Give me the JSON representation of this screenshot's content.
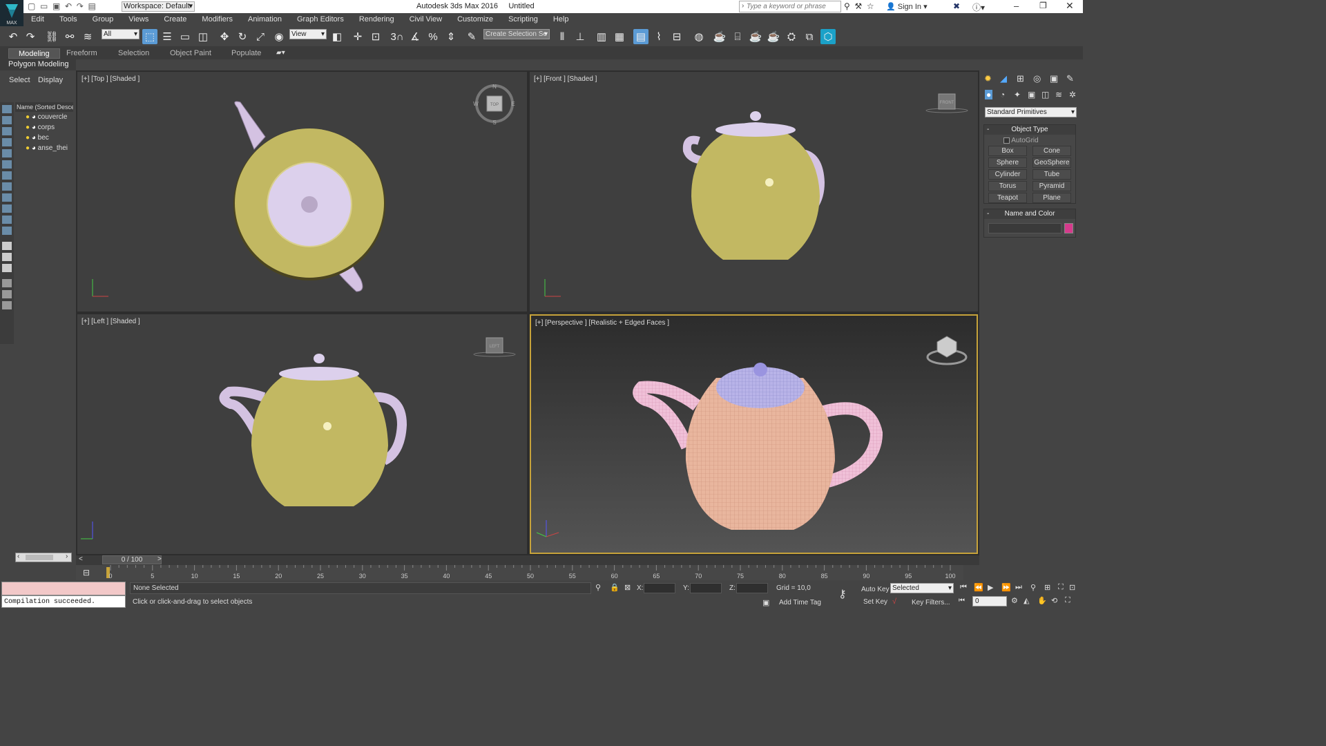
{
  "window": {
    "title": "Autodesk 3ds Max 2016",
    "doc": "Untitled",
    "workspace": "Workspace: Default",
    "search_placeholder": "Type a keyword or phrase",
    "signin": "Sign In",
    "logo_text": "MAX"
  },
  "menu": [
    "Edit",
    "Tools",
    "Group",
    "Views",
    "Create",
    "Modifiers",
    "Animation",
    "Graph Editors",
    "Rendering",
    "Civil View",
    "Customize",
    "Scripting",
    "Help"
  ],
  "toolbar": {
    "filter_value": "All",
    "refcoord_value": "View",
    "selection_set_placeholder": "Create Selection Se",
    "snap_label": "3",
    "percent_label": "%"
  },
  "ribbon": {
    "tabs": [
      "Modeling",
      "Freeform",
      "Selection",
      "Object Paint",
      "Populate"
    ],
    "active": "Modeling",
    "sub": "Polygon Modeling"
  },
  "scene_explorer": {
    "tabs": [
      "Select",
      "Display"
    ],
    "column": "Name (Sorted Desce",
    "items": [
      "couvercle",
      "corps",
      "bec",
      "anse_thei"
    ]
  },
  "viewports": {
    "top": "[+] [Top ] [Shaded ]",
    "front": "[+] [Front ] [Shaded ]",
    "left": "[+] [Left ] [Shaded ]",
    "perspective": "[+] [Perspective ] [Realistic + Edged Faces ]",
    "compass": {
      "n": "N",
      "s": "S",
      "e": "E",
      "w": "W",
      "cube": "TOP"
    },
    "front_cube": "FRONT",
    "left_cube": "LEFT",
    "colors": {
      "body": "#c9c06a",
      "lid": "#e3d3ef",
      "wire_body": "#f0b8a8",
      "wire_lid": "#b8b3e8",
      "frame": "#c7a33a"
    }
  },
  "command_panel": {
    "dropdown": "Standard Primitives",
    "object_type": "Object Type",
    "autogrid": "AutoGrid",
    "buttons": [
      "Box",
      "Cone",
      "Sphere",
      "GeoSphere",
      "Cylinder",
      "Tube",
      "Torus",
      "Pyramid",
      "Teapot",
      "Plane"
    ],
    "name_and_color": "Name and Color",
    "swatch_color": "#d63a8c"
  },
  "timeline": {
    "position": "0 / 100",
    "ticks": [
      "0",
      "5",
      "10",
      "15",
      "20",
      "25",
      "30",
      "35",
      "40",
      "45",
      "50",
      "55",
      "60",
      "65",
      "70",
      "75",
      "80",
      "85",
      "90",
      "95",
      "100"
    ],
    "prev": "<",
    "next": ">"
  },
  "status": {
    "listener": "Compilation succeeded.",
    "selection": "None Selected",
    "prompt": "Click or click-and-drag to select objects",
    "x_label": "X:",
    "y_label": "Y:",
    "z_label": "Z:",
    "grid": "Grid = 10,0",
    "add_time_tag": "Add Time Tag",
    "auto_key": "Auto Key",
    "set_key": "Set Key",
    "selected_value": "Selected",
    "key_filters": "Key Filters...",
    "frame_value": "0"
  }
}
